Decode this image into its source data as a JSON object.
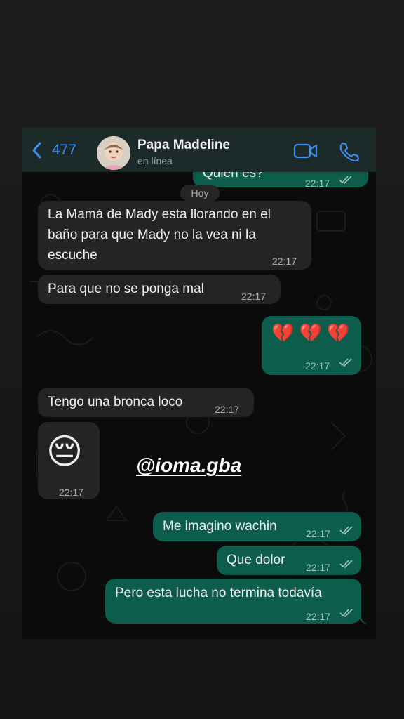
{
  "header": {
    "back_count": "477",
    "contact_name": "Papa Madeline",
    "contact_status": "en línea"
  },
  "day_separator": "Hoy",
  "messages": [
    {
      "direction": "out",
      "text": "Quien es?",
      "time": "22:17"
    },
    {
      "direction": "in",
      "lines": [
        "La Mamá de Mady esta llorando en el",
        "baño para que Mady no la vea ni la",
        "escuche"
      ],
      "time": "22:17"
    },
    {
      "direction": "in",
      "text": "Para que no se ponga mal",
      "time": "22:17"
    },
    {
      "direction": "out",
      "text": "💔 💔 💔",
      "time": "22:17"
    },
    {
      "direction": "in",
      "text": "Tengo una bronca loco",
      "time": "22:17"
    },
    {
      "direction": "in",
      "text": "😔",
      "time": "22:17"
    },
    {
      "direction": "out",
      "text": "Me imagino wachin",
      "time": "22:17"
    },
    {
      "direction": "out",
      "text": "Que dolor",
      "time": "22:17"
    },
    {
      "direction": "out",
      "text": "Pero esta lucha no termina todavía",
      "time": "22:17"
    }
  ],
  "watermark": "@ioma.gba",
  "colors": {
    "accent": "#3b8ff5",
    "incoming_bubble": "#242424",
    "outgoing_bubble": "#0d5d4c",
    "chat_bg": "#0b0b0b"
  },
  "icons": [
    "chevron-left-icon",
    "video-call-icon",
    "phone-icon",
    "double-check-icon"
  ]
}
